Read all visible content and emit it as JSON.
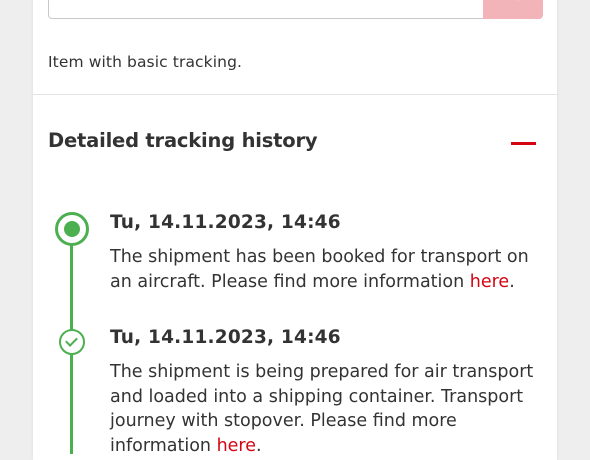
{
  "tracking": {
    "basic_text": "Item with basic tracking.",
    "section_title": "Detailed tracking history",
    "events": [
      {
        "date": "Tu, 14.11.2023, 14:46",
        "text": "The shipment has been booked for transport on an aircraft. Please find more information ",
        "link_label": "here",
        "text_after": ".",
        "status": "current"
      },
      {
        "date": "Tu, 14.11.2023, 14:46",
        "text": "The shipment is being prepared for air transport and loaded into a shipping container. Transport journey with stopover. Please find more information ",
        "link_label": "here",
        "text_after": ".",
        "status": "done"
      }
    ]
  },
  "colors": {
    "accent_red": "#d40511",
    "progress_green": "#4caf50",
    "search_button": "#f2b4b8"
  },
  "icons": {
    "search_button": "search-icon",
    "collapse": "minus-icon",
    "current_marker": "radio-dot-icon",
    "done_marker": "check-circle-icon"
  }
}
